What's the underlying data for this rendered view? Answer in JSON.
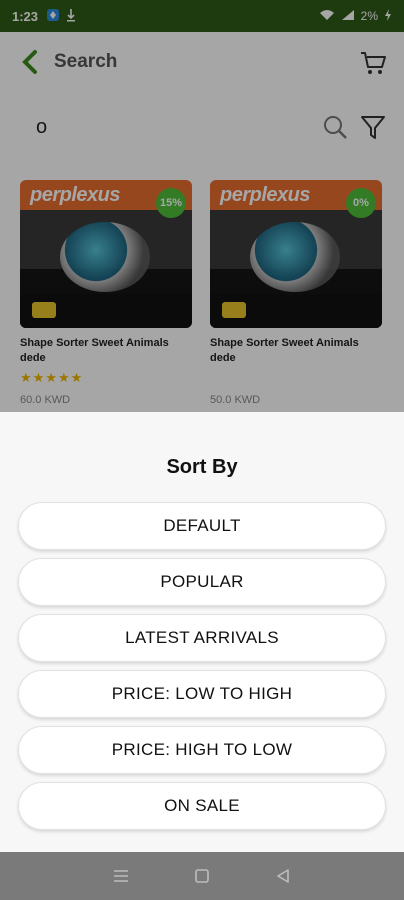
{
  "status_bar": {
    "time": "1:23",
    "battery": "2%"
  },
  "header": {
    "title": "Search"
  },
  "search": {
    "value": "o"
  },
  "products": [
    {
      "brand": "perplexus",
      "badge": "15%",
      "name": "Shape Sorter Sweet Animals dede",
      "stars": "★★★★★",
      "price": "60.0 KWD"
    },
    {
      "brand": "perplexus",
      "badge": "0%",
      "name": "Shape Sorter Sweet Animals dede",
      "stars": "",
      "price": "50.0 KWD"
    }
  ],
  "sort_sheet": {
    "title": "Sort By",
    "options": [
      "DEFAULT",
      "POPULAR",
      "LATEST ARRIVALS",
      "PRICE: LOW TO HIGH",
      "PRICE: HIGH TO LOW",
      "ON SALE"
    ]
  },
  "colors": {
    "status_bar": "#2f5a18",
    "accent_green": "#3d8b1b",
    "badge_green": "#4fbf3a",
    "star": "#f0b400"
  },
  "icons": {
    "back": "chevron-left-icon",
    "cart": "cart-icon",
    "search": "search-icon",
    "filter": "filter-icon",
    "nav_menu": "menu-icon",
    "nav_home": "square-icon",
    "nav_back": "triangle-back-icon"
  }
}
